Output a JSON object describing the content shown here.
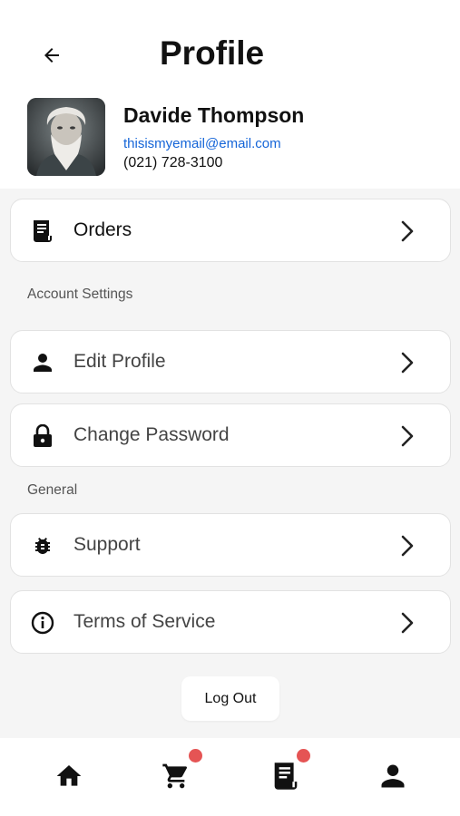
{
  "header": {
    "title": "Profile"
  },
  "profile": {
    "name": "Davide Thompson",
    "email": "thisismyemail@email.com",
    "phone": "(021) 728-3100"
  },
  "menu": {
    "orders": {
      "label": "Orders",
      "icon": "receipt-icon"
    },
    "account_settings_label": "Account Settings",
    "edit_profile": {
      "label": "Edit Profile",
      "icon": "person-icon"
    },
    "change_password": {
      "label": "Change Password",
      "icon": "lock-icon"
    },
    "general_label": "General",
    "support": {
      "label": "Support",
      "icon": "bug-icon"
    },
    "terms": {
      "label": "Terms of Service",
      "icon": "info-icon"
    }
  },
  "logout_label": "Log Out",
  "bottom_nav": {
    "items": [
      "home-icon",
      "cart-icon",
      "receipt-icon",
      "person-icon"
    ],
    "badge_color": "#e55454"
  },
  "colors": {
    "email_link": "#1565d8",
    "background": "#f5f5f5"
  }
}
